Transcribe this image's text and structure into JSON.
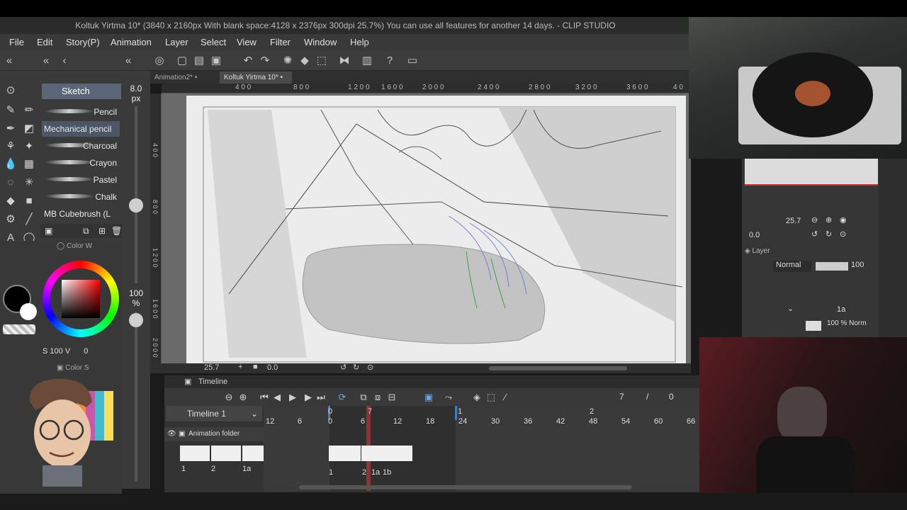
{
  "window": {
    "title": "Koltuk Yirtma 10* (3840 x 2160px With blank space:4128 x 2376px 300dpi 25.7%)  You can use all features for another 14 days. - CLIP STUDIO"
  },
  "menu": [
    "File",
    "Edit",
    "Story(P)",
    "Animation",
    "Layer",
    "Select",
    "View",
    "Filter",
    "Window",
    "Help"
  ],
  "tabs": [
    {
      "label": "Animation2*",
      "active": false
    },
    {
      "label": "Koltuk Yirtma 10*",
      "active": true
    }
  ],
  "tool": {
    "group": "Sketch",
    "brush_size_value": "8.0",
    "brush_size_unit": "px",
    "opacity_value": "100",
    "opacity_unit": "%"
  },
  "subtools": [
    "Pencil",
    "Mechanical pencil",
    "Charcoal",
    "Crayon",
    "Pastel",
    "Chalk",
    "MB Cubebrush (L"
  ],
  "color_panel": {
    "title": "Color W",
    "s_label": "S",
    "s_value": "100",
    "v_label": "V",
    "v_value": "0",
    "main_color": "#000000",
    "sub_color": "#ffffff"
  },
  "color_set_panel": {
    "title": "Color S"
  },
  "rulers": {
    "h": [
      "4 0 0",
      "8 0 0",
      "1 2 0 0",
      "1 6 0 0",
      "2 0 0 0",
      "2 4 0 0",
      "2 8 0 0",
      "3 2 0 0",
      "3 6 0 0",
      "4 0"
    ],
    "v": [
      "4 0 0",
      "8 0 0",
      "1 2 0 0",
      "1 6 0 0",
      "2 0 0 0"
    ]
  },
  "canvas_status": {
    "zoom": "25.7",
    "rotation": "0.0"
  },
  "timeline": {
    "panel_title": "Timeline",
    "name": "Timeline 1",
    "current_frame": "7",
    "separator": "/",
    "frame_field": "0",
    "layer_name": "Animation folder",
    "ruler_top": [
      "0",
      "7",
      "1",
      "2"
    ],
    "ruler_numbers": [
      "12",
      "6",
      "0",
      "6",
      "12",
      "18",
      "24",
      "30",
      "36",
      "42",
      "48",
      "54",
      "60",
      "66"
    ],
    "left_cels": [
      "1",
      "2",
      "1a"
    ],
    "frame_cels": [
      "1",
      "2",
      "1a",
      "1b"
    ]
  },
  "navigator": {
    "zoom": "25.7",
    "rotation": "0.0"
  },
  "layer_panel": {
    "title": "Layer",
    "blend_mode": "Normal",
    "opacity": "100",
    "item_name": "1a",
    "item_info": "100 % Norm"
  }
}
